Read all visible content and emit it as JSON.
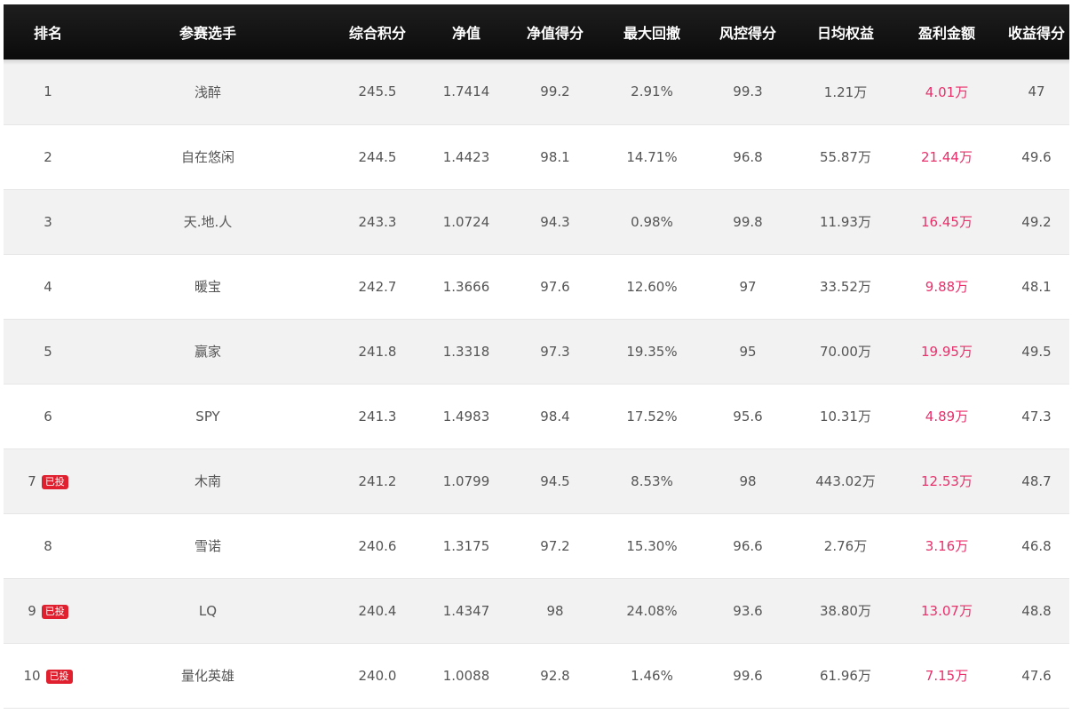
{
  "headers": {
    "rank": "排名",
    "player": "参赛选手",
    "score": "综合积分",
    "nav": "净值",
    "nav_score": "净值得分",
    "drawdown": "最大回撤",
    "risk_score": "风控得分",
    "avg_equity": "日均权益",
    "profit": "盈利金额",
    "return_score": "收益得分"
  },
  "badge_label": "已投",
  "colors": {
    "header_bg": "#111111",
    "profit": "#e8306b",
    "badge": "#e0202e"
  },
  "rows": [
    {
      "rank": "1",
      "badge": "",
      "player": "浅醉",
      "score": "245.5",
      "nav": "1.7414",
      "nav_score": "99.2",
      "drawdown": "2.91%",
      "risk_score": "99.3",
      "avg_equity": "1.21万",
      "profit": "4.01万",
      "return_score": "47"
    },
    {
      "rank": "2",
      "badge": "",
      "player": "自在悠闲",
      "score": "244.5",
      "nav": "1.4423",
      "nav_score": "98.1",
      "drawdown": "14.71%",
      "risk_score": "96.8",
      "avg_equity": "55.87万",
      "profit": "21.44万",
      "return_score": "49.6"
    },
    {
      "rank": "3",
      "badge": "",
      "player": "天.地.人",
      "score": "243.3",
      "nav": "1.0724",
      "nav_score": "94.3",
      "drawdown": "0.98%",
      "risk_score": "99.8",
      "avg_equity": "11.93万",
      "profit": "16.45万",
      "return_score": "49.2"
    },
    {
      "rank": "4",
      "badge": "",
      "player": "暖宝",
      "score": "242.7",
      "nav": "1.3666",
      "nav_score": "97.6",
      "drawdown": "12.60%",
      "risk_score": "97",
      "avg_equity": "33.52万",
      "profit": "9.88万",
      "return_score": "48.1"
    },
    {
      "rank": "5",
      "badge": "",
      "player": "赢家",
      "score": "241.8",
      "nav": "1.3318",
      "nav_score": "97.3",
      "drawdown": "19.35%",
      "risk_score": "95",
      "avg_equity": "70.00万",
      "profit": "19.95万",
      "return_score": "49.5"
    },
    {
      "rank": "6",
      "badge": "",
      "player": "SPY",
      "score": "241.3",
      "nav": "1.4983",
      "nav_score": "98.4",
      "drawdown": "17.52%",
      "risk_score": "95.6",
      "avg_equity": "10.31万",
      "profit": "4.89万",
      "return_score": "47.3"
    },
    {
      "rank": "7",
      "badge": "已投",
      "player": "木南",
      "score": "241.2",
      "nav": "1.0799",
      "nav_score": "94.5",
      "drawdown": "8.53%",
      "risk_score": "98",
      "avg_equity": "443.02万",
      "profit": "12.53万",
      "return_score": "48.7"
    },
    {
      "rank": "8",
      "badge": "",
      "player": "雪诺",
      "score": "240.6",
      "nav": "1.3175",
      "nav_score": "97.2",
      "drawdown": "15.30%",
      "risk_score": "96.6",
      "avg_equity": "2.76万",
      "profit": "3.16万",
      "return_score": "46.8"
    },
    {
      "rank": "9",
      "badge": "已投",
      "player": "LQ",
      "score": "240.4",
      "nav": "1.4347",
      "nav_score": "98",
      "drawdown": "24.08%",
      "risk_score": "93.6",
      "avg_equity": "38.80万",
      "profit": "13.07万",
      "return_score": "48.8"
    },
    {
      "rank": "10",
      "badge": "已投",
      "player": "量化英雄",
      "score": "240.0",
      "nav": "1.0088",
      "nav_score": "92.8",
      "drawdown": "1.46%",
      "risk_score": "99.6",
      "avg_equity": "61.96万",
      "profit": "7.15万",
      "return_score": "47.6"
    }
  ]
}
